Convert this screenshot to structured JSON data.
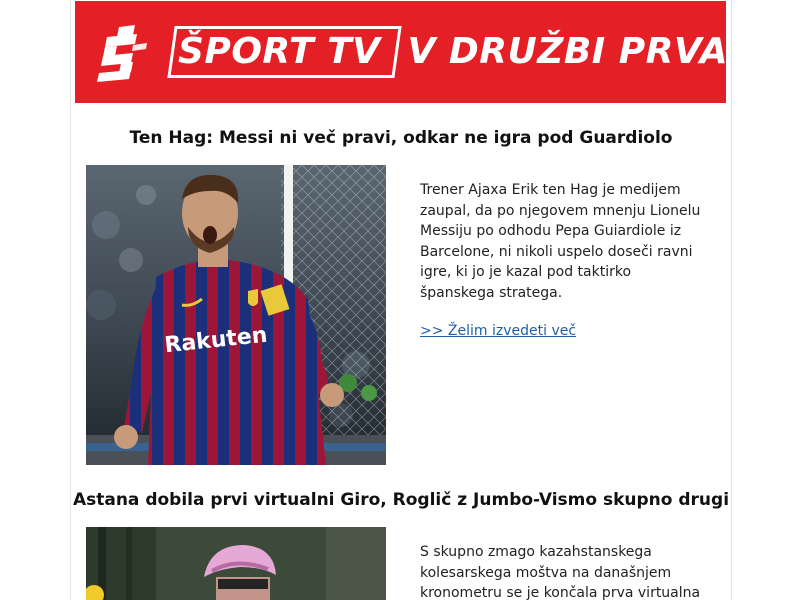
{
  "banner": {
    "logo_icon": "sport-tv-s-logo-icon",
    "brand": "ŠPORT TV",
    "slogan": "V DRUŽBI PRVAKOV!",
    "color": "#e41f26"
  },
  "articles": [
    {
      "title": "Ten Hag: Messi ni več pravi, odkar ne igra pod Guardiolo",
      "summary": "Trener Ajaxa Erik ten Hag je medijem zaupal, da po njegovem mnenju Lionelu Messiju po odhodu Pepa Guiardiole iz Barcelone, ni nikoli uspelo doseči ravni igre, ki jo je kazal pod taktirko španskega stratega.",
      "link_label": ">> Želim izvedeti več",
      "shirt_sponsor": "Rakuten"
    },
    {
      "title": "Astana dobila prvi virtualni Giro, Roglič z Jumbo-Vismo skupno drugi",
      "summary": "S skupno zmago kazahstanskega kolesarskega moštva na današnjem kronometru se je končala prva virtualna"
    }
  ],
  "colors": {
    "link": "#1f5fa8",
    "text": "#222222"
  }
}
